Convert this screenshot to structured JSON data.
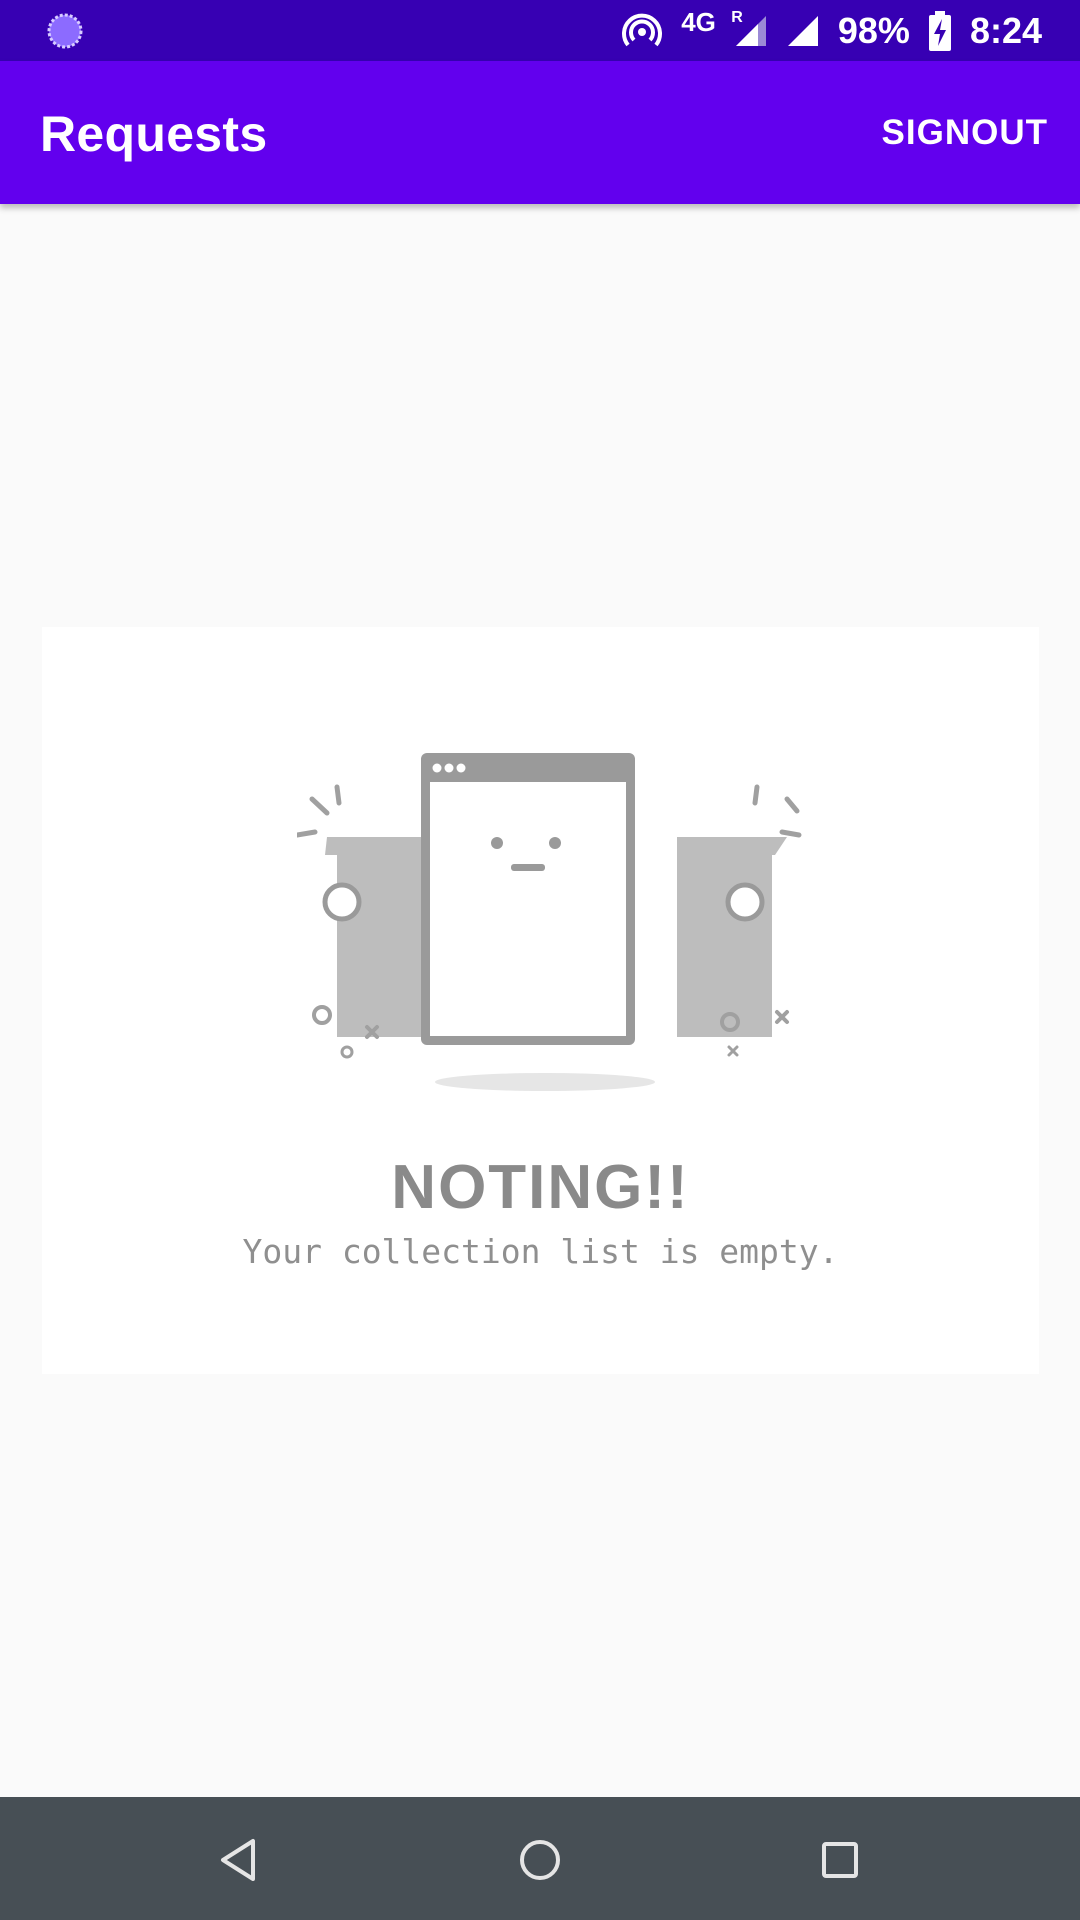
{
  "status_bar": {
    "network_label": "4G",
    "roaming_label": "R",
    "battery_percent": "98%",
    "time": "8:24",
    "icons": [
      "app-notification-icon",
      "hotspot-icon",
      "signal-roaming-icon",
      "signal-icon",
      "battery-charging-icon"
    ]
  },
  "app_bar": {
    "title": "Requests",
    "signout_label": "SIGNOUT",
    "background_color": "#6200ee",
    "status_color": "#3700b3"
  },
  "empty_state": {
    "title": "NOTING!!",
    "subtitle": "Your collection list is empty.",
    "illustration_icon": "empty-document-illustration"
  },
  "nav_bar": {
    "icons": [
      "back-icon",
      "home-icon",
      "recents-icon"
    ]
  }
}
